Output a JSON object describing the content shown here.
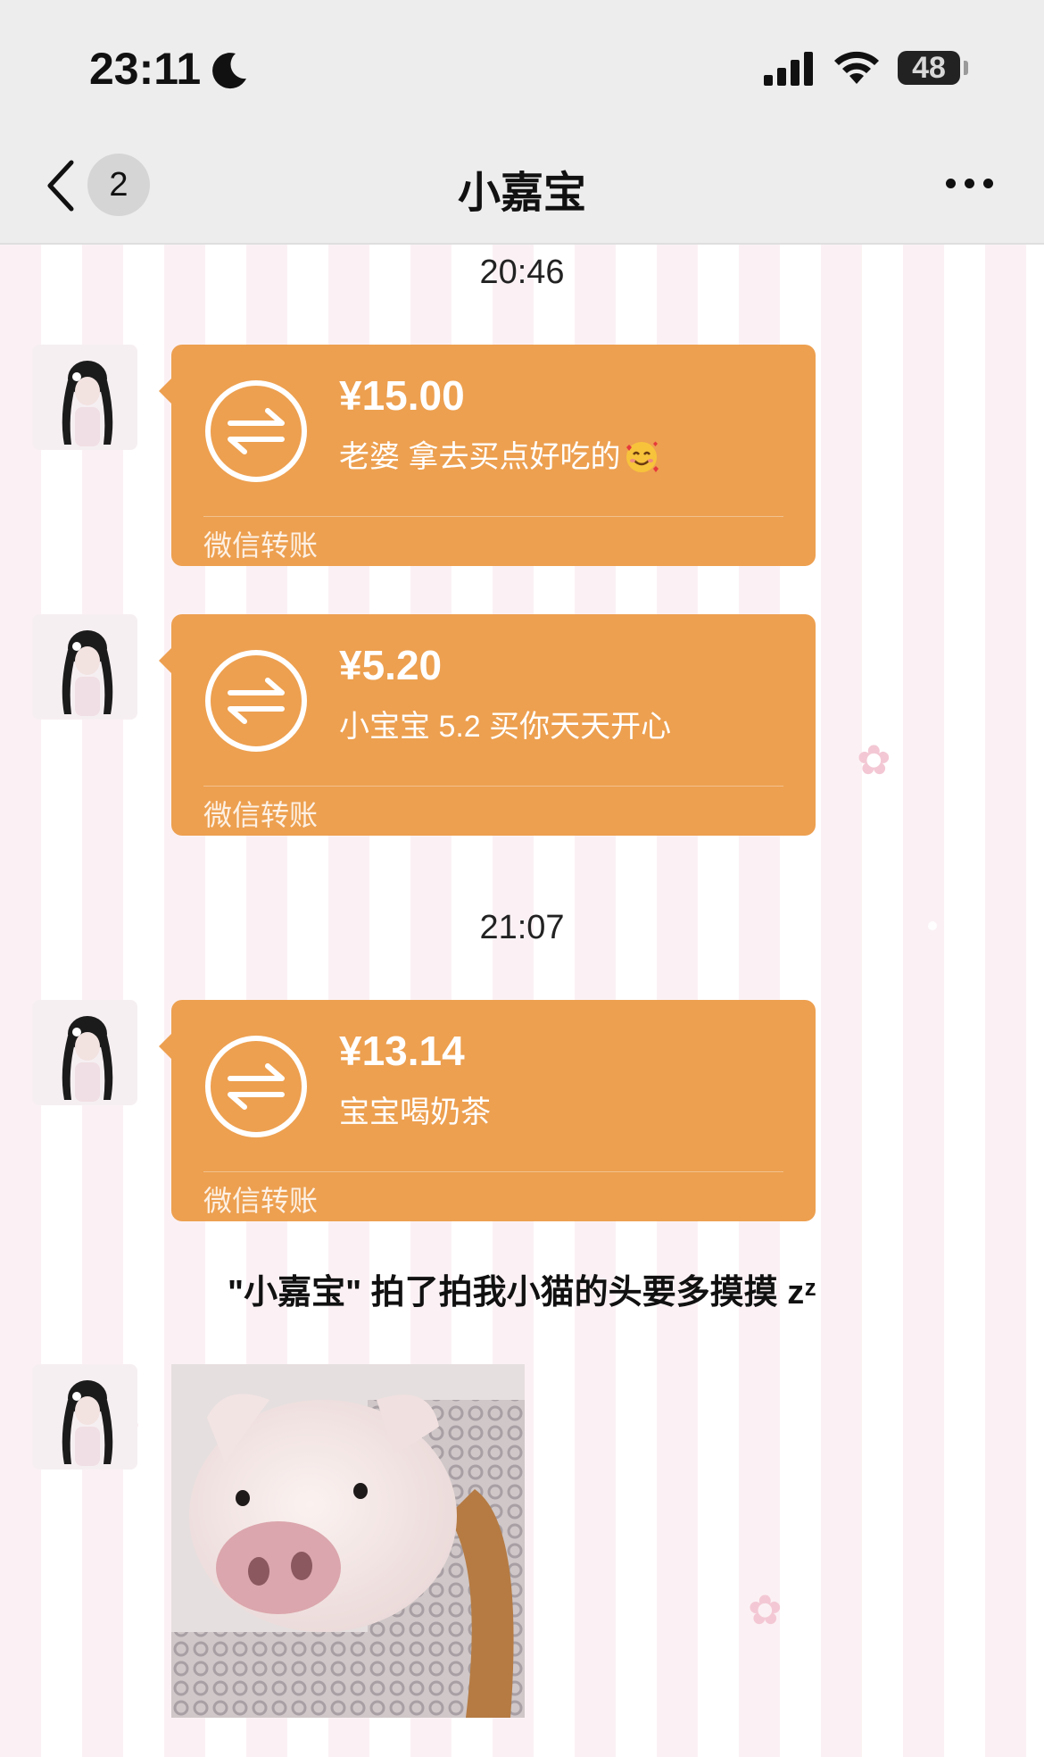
{
  "status_bar": {
    "time": "23:11",
    "battery": "48"
  },
  "nav": {
    "unread_count": "2",
    "title": "小嘉宝"
  },
  "messages": {
    "timestamp_1": "20:46",
    "transfer_1": {
      "amount": "¥15.00",
      "note": "老婆 拿去买点好吃的",
      "label": "微信转账"
    },
    "transfer_2": {
      "amount": "¥5.20",
      "note": "小宝宝 5.2 买你天天开心",
      "label": "微信转账"
    },
    "timestamp_2": "21:07",
    "transfer_3": {
      "amount": "¥13.14",
      "note": "宝宝喝奶茶",
      "label": "微信转账"
    },
    "pat_text": "\"小嘉宝\" 拍了拍我小猫的头要多摸摸 zᶻ"
  },
  "colors": {
    "transfer_card": "#eda050",
    "nav_bg": "#ededed",
    "wallpaper_stripe": "#fbf1f4"
  },
  "icons": {
    "back": "chevron-left-icon",
    "more": "more-dots-icon",
    "transfer": "transfer-arrows-icon",
    "status": [
      "moon-icon",
      "signal-icon",
      "wifi-icon",
      "battery-icon"
    ]
  }
}
